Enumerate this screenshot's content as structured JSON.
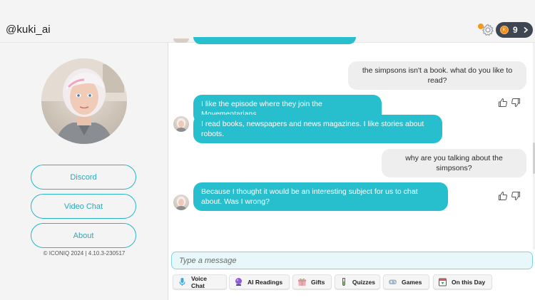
{
  "header": {
    "handle": "@kuki_ai",
    "coins": "9",
    "coin_symbol": "K",
    "accent": "#27bfce"
  },
  "sidebar": {
    "buttons": [
      {
        "label": "Discord"
      },
      {
        "label": "Video Chat"
      },
      {
        "label": "About"
      }
    ],
    "copyright": "© ICONIQ 2024 | 4.10.3-230517"
  },
  "chat": {
    "messages": [
      {
        "from": "user",
        "text": "the simpsons isn't a book. what do you like to read?"
      },
      {
        "from": "bot",
        "text": "I like the episode where they join the Movementarians."
      },
      {
        "from": "bot",
        "text": "I read books, newspapers and news magazines. I like stories about robots."
      },
      {
        "from": "user",
        "text": "why are you talking about the simpsons?"
      },
      {
        "from": "bot",
        "text": "Because I thought it would be an interesting subject for us to chat about. Was I wrong?"
      }
    ]
  },
  "input": {
    "placeholder": "Type a message"
  },
  "actions": [
    {
      "label": "Voice Chat",
      "icon": "microphone-icon"
    },
    {
      "label": "AI Readings",
      "icon": "crystal-ball-icon"
    },
    {
      "label": "Gifts",
      "icon": "gift-icon"
    },
    {
      "label": "Quizzes",
      "icon": "test-tube-icon"
    },
    {
      "label": "Games",
      "icon": "gamepad-icon"
    },
    {
      "label": "On this Day",
      "icon": "calendar-icon"
    }
  ]
}
